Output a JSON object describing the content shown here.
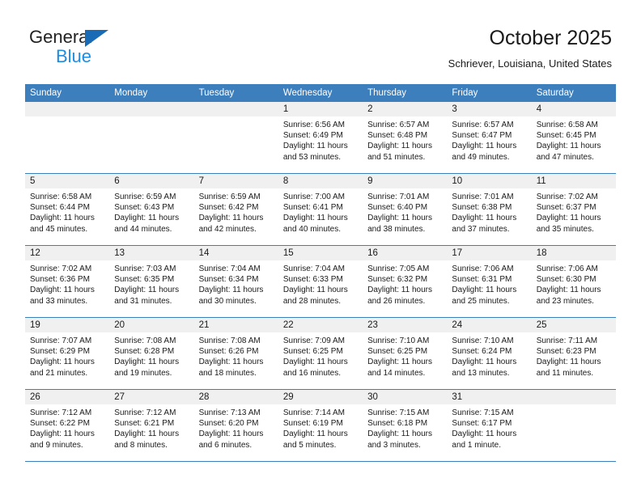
{
  "brand": {
    "name_line1": "General",
    "name_line2": "Blue",
    "logo_icon": "triangle-logo-icon",
    "accent_color": "#1f8ce0",
    "triangle_color": "#1a6bb5"
  },
  "header": {
    "title": "October 2025",
    "subtitle": "Schriever, Louisiana, United States",
    "header_bg_color": "#3d7ebd",
    "daynum_band_color": "#f0f0f0"
  },
  "weekday_headers": [
    "Sunday",
    "Monday",
    "Tuesday",
    "Wednesday",
    "Thursday",
    "Friday",
    "Saturday"
  ],
  "weeks": [
    [
      {
        "day": "",
        "empty": true
      },
      {
        "day": "",
        "empty": true
      },
      {
        "day": "",
        "empty": true
      },
      {
        "day": "1",
        "sunrise": "Sunrise: 6:56 AM",
        "sunset": "Sunset: 6:49 PM",
        "daylight_line1": "Daylight: 11 hours",
        "daylight_line2": "and 53 minutes."
      },
      {
        "day": "2",
        "sunrise": "Sunrise: 6:57 AM",
        "sunset": "Sunset: 6:48 PM",
        "daylight_line1": "Daylight: 11 hours",
        "daylight_line2": "and 51 minutes."
      },
      {
        "day": "3",
        "sunrise": "Sunrise: 6:57 AM",
        "sunset": "Sunset: 6:47 PM",
        "daylight_line1": "Daylight: 11 hours",
        "daylight_line2": "and 49 minutes."
      },
      {
        "day": "4",
        "sunrise": "Sunrise: 6:58 AM",
        "sunset": "Sunset: 6:45 PM",
        "daylight_line1": "Daylight: 11 hours",
        "daylight_line2": "and 47 minutes."
      }
    ],
    [
      {
        "day": "5",
        "sunrise": "Sunrise: 6:58 AM",
        "sunset": "Sunset: 6:44 PM",
        "daylight_line1": "Daylight: 11 hours",
        "daylight_line2": "and 45 minutes."
      },
      {
        "day": "6",
        "sunrise": "Sunrise: 6:59 AM",
        "sunset": "Sunset: 6:43 PM",
        "daylight_line1": "Daylight: 11 hours",
        "daylight_line2": "and 44 minutes."
      },
      {
        "day": "7",
        "sunrise": "Sunrise: 6:59 AM",
        "sunset": "Sunset: 6:42 PM",
        "daylight_line1": "Daylight: 11 hours",
        "daylight_line2": "and 42 minutes."
      },
      {
        "day": "8",
        "sunrise": "Sunrise: 7:00 AM",
        "sunset": "Sunset: 6:41 PM",
        "daylight_line1": "Daylight: 11 hours",
        "daylight_line2": "and 40 minutes."
      },
      {
        "day": "9",
        "sunrise": "Sunrise: 7:01 AM",
        "sunset": "Sunset: 6:40 PM",
        "daylight_line1": "Daylight: 11 hours",
        "daylight_line2": "and 38 minutes."
      },
      {
        "day": "10",
        "sunrise": "Sunrise: 7:01 AM",
        "sunset": "Sunset: 6:38 PM",
        "daylight_line1": "Daylight: 11 hours",
        "daylight_line2": "and 37 minutes."
      },
      {
        "day": "11",
        "sunrise": "Sunrise: 7:02 AM",
        "sunset": "Sunset: 6:37 PM",
        "daylight_line1": "Daylight: 11 hours",
        "daylight_line2": "and 35 minutes."
      }
    ],
    [
      {
        "day": "12",
        "sunrise": "Sunrise: 7:02 AM",
        "sunset": "Sunset: 6:36 PM",
        "daylight_line1": "Daylight: 11 hours",
        "daylight_line2": "and 33 minutes."
      },
      {
        "day": "13",
        "sunrise": "Sunrise: 7:03 AM",
        "sunset": "Sunset: 6:35 PM",
        "daylight_line1": "Daylight: 11 hours",
        "daylight_line2": "and 31 minutes."
      },
      {
        "day": "14",
        "sunrise": "Sunrise: 7:04 AM",
        "sunset": "Sunset: 6:34 PM",
        "daylight_line1": "Daylight: 11 hours",
        "daylight_line2": "and 30 minutes."
      },
      {
        "day": "15",
        "sunrise": "Sunrise: 7:04 AM",
        "sunset": "Sunset: 6:33 PM",
        "daylight_line1": "Daylight: 11 hours",
        "daylight_line2": "and 28 minutes."
      },
      {
        "day": "16",
        "sunrise": "Sunrise: 7:05 AM",
        "sunset": "Sunset: 6:32 PM",
        "daylight_line1": "Daylight: 11 hours",
        "daylight_line2": "and 26 minutes."
      },
      {
        "day": "17",
        "sunrise": "Sunrise: 7:06 AM",
        "sunset": "Sunset: 6:31 PM",
        "daylight_line1": "Daylight: 11 hours",
        "daylight_line2": "and 25 minutes."
      },
      {
        "day": "18",
        "sunrise": "Sunrise: 7:06 AM",
        "sunset": "Sunset: 6:30 PM",
        "daylight_line1": "Daylight: 11 hours",
        "daylight_line2": "and 23 minutes."
      }
    ],
    [
      {
        "day": "19",
        "sunrise": "Sunrise: 7:07 AM",
        "sunset": "Sunset: 6:29 PM",
        "daylight_line1": "Daylight: 11 hours",
        "daylight_line2": "and 21 minutes."
      },
      {
        "day": "20",
        "sunrise": "Sunrise: 7:08 AM",
        "sunset": "Sunset: 6:28 PM",
        "daylight_line1": "Daylight: 11 hours",
        "daylight_line2": "and 19 minutes."
      },
      {
        "day": "21",
        "sunrise": "Sunrise: 7:08 AM",
        "sunset": "Sunset: 6:26 PM",
        "daylight_line1": "Daylight: 11 hours",
        "daylight_line2": "and 18 minutes."
      },
      {
        "day": "22",
        "sunrise": "Sunrise: 7:09 AM",
        "sunset": "Sunset: 6:25 PM",
        "daylight_line1": "Daylight: 11 hours",
        "daylight_line2": "and 16 minutes."
      },
      {
        "day": "23",
        "sunrise": "Sunrise: 7:10 AM",
        "sunset": "Sunset: 6:25 PM",
        "daylight_line1": "Daylight: 11 hours",
        "daylight_line2": "and 14 minutes."
      },
      {
        "day": "24",
        "sunrise": "Sunrise: 7:10 AM",
        "sunset": "Sunset: 6:24 PM",
        "daylight_line1": "Daylight: 11 hours",
        "daylight_line2": "and 13 minutes."
      },
      {
        "day": "25",
        "sunrise": "Sunrise: 7:11 AM",
        "sunset": "Sunset: 6:23 PM",
        "daylight_line1": "Daylight: 11 hours",
        "daylight_line2": "and 11 minutes."
      }
    ],
    [
      {
        "day": "26",
        "sunrise": "Sunrise: 7:12 AM",
        "sunset": "Sunset: 6:22 PM",
        "daylight_line1": "Daylight: 11 hours",
        "daylight_line2": "and 9 minutes."
      },
      {
        "day": "27",
        "sunrise": "Sunrise: 7:12 AM",
        "sunset": "Sunset: 6:21 PM",
        "daylight_line1": "Daylight: 11 hours",
        "daylight_line2": "and 8 minutes."
      },
      {
        "day": "28",
        "sunrise": "Sunrise: 7:13 AM",
        "sunset": "Sunset: 6:20 PM",
        "daylight_line1": "Daylight: 11 hours",
        "daylight_line2": "and 6 minutes."
      },
      {
        "day": "29",
        "sunrise": "Sunrise: 7:14 AM",
        "sunset": "Sunset: 6:19 PM",
        "daylight_line1": "Daylight: 11 hours",
        "daylight_line2": "and 5 minutes."
      },
      {
        "day": "30",
        "sunrise": "Sunrise: 7:15 AM",
        "sunset": "Sunset: 6:18 PM",
        "daylight_line1": "Daylight: 11 hours",
        "daylight_line2": "and 3 minutes."
      },
      {
        "day": "31",
        "sunrise": "Sunrise: 7:15 AM",
        "sunset": "Sunset: 6:17 PM",
        "daylight_line1": "Daylight: 11 hours",
        "daylight_line2": "and 1 minute."
      },
      {
        "day": "",
        "empty": true
      }
    ]
  ]
}
